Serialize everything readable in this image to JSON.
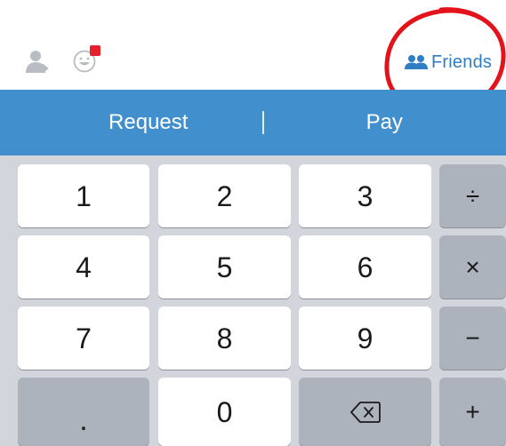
{
  "header": {
    "friends_label": "Friends",
    "notification_color": "#e6202a",
    "icons": [
      "contact-icon",
      "emoji-icon",
      "friends-icon"
    ]
  },
  "tabs": {
    "request_label": "Request",
    "pay_label": "Pay",
    "bar_color": "#4190cd"
  },
  "keypad": {
    "keys": [
      {
        "id": "1",
        "label": "1"
      },
      {
        "id": "2",
        "label": "2"
      },
      {
        "id": "3",
        "label": "3"
      },
      {
        "id": "divide",
        "label": "÷"
      },
      {
        "id": "4",
        "label": "4"
      },
      {
        "id": "5",
        "label": "5"
      },
      {
        "id": "6",
        "label": "6"
      },
      {
        "id": "multiply",
        "label": "×"
      },
      {
        "id": "7",
        "label": "7"
      },
      {
        "id": "8",
        "label": "8"
      },
      {
        "id": "9",
        "label": "9"
      },
      {
        "id": "minus",
        "label": "−"
      },
      {
        "id": "dot",
        "label": "."
      },
      {
        "id": "0",
        "label": "0"
      },
      {
        "id": "backspace",
        "label": "",
        "icon": "backspace-icon"
      },
      {
        "id": "plus",
        "label": "+"
      }
    ]
  },
  "annotation": {
    "circle_color": "#e3121b",
    "circle_target": "Friends"
  }
}
